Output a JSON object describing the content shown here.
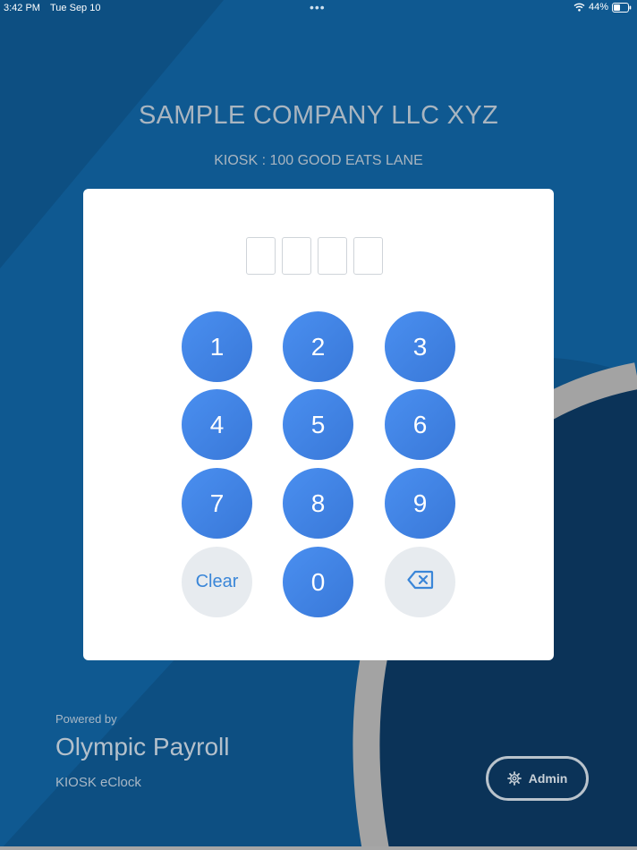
{
  "status_bar": {
    "time": "3:42 PM",
    "date": "Tue Sep 10",
    "dots": "•••",
    "battery": "44%",
    "wifi_icon": "wifi-icon",
    "battery_icon": "battery-icon"
  },
  "header": {
    "company": "SAMPLE COMPANY LLC XYZ",
    "kiosk": "KIOSK : 100 GOOD EATS LANE"
  },
  "keypad": {
    "keys": [
      "1",
      "2",
      "3",
      "4",
      "5",
      "6",
      "7",
      "8",
      "9",
      "Clear",
      "0"
    ],
    "backspace_icon": "backspace-icon"
  },
  "footer": {
    "powered_by": "Powered by",
    "brand": "Olympic Payroll",
    "product": "KIOSK eClock",
    "admin_label": "Admin",
    "admin_icon": "gear-icon"
  },
  "colors": {
    "background": "#0d4f82",
    "key_blue": "#4287ea",
    "key_light": "#e7ebef",
    "ring": "#a0a0a0"
  }
}
